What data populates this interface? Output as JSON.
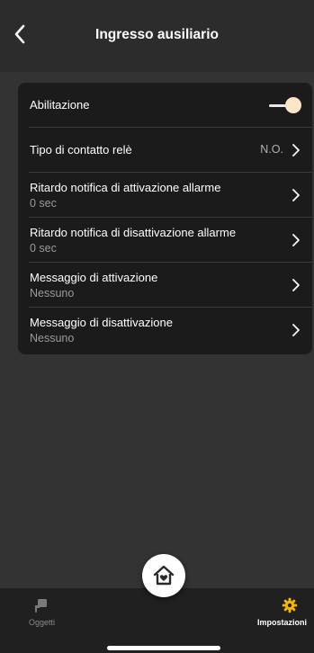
{
  "header": {
    "title": "Ingresso ausiliario"
  },
  "settings": {
    "enable": {
      "label": "Abilitazione",
      "enabled": true
    },
    "relay_contact": {
      "label": "Tipo di contatto relè",
      "value": "N.O."
    },
    "activation_delay": {
      "label": "Ritardo notifica di attivazione allarme",
      "value": "0 sec"
    },
    "deactivation_delay": {
      "label": "Ritardo notifica di disattivazione allarme",
      "value": "0 sec"
    },
    "activation_message": {
      "label": "Messaggio di attivazione",
      "value": "Nessuno"
    },
    "deactivation_message": {
      "label": "Messaggio di disattivazione",
      "value": "Nessuno"
    }
  },
  "nav": {
    "objects_label": "Oggetti",
    "settings_label": "Impostazioni",
    "active": "settings"
  },
  "colors": {
    "background": "#333333",
    "card": "#1b1b1b",
    "toggle_knob": "#fbe6c8",
    "active_nav": "#f5b800"
  },
  "icons": {
    "back": "chevron-left-icon",
    "row_chevron": "chevron-right-icon",
    "objects": "plug-icon",
    "settings": "gear-icon",
    "home": "home-heart-icon"
  }
}
